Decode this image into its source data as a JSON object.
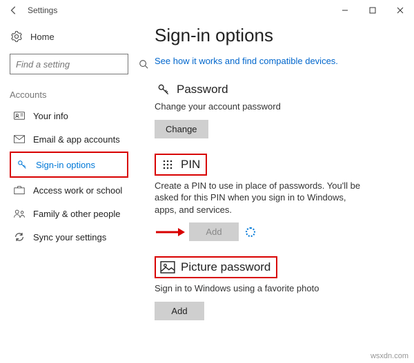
{
  "window": {
    "title": "Settings"
  },
  "sidebar": {
    "home": "Home",
    "search_placeholder": "Find a setting",
    "group": "Accounts",
    "items": [
      {
        "label": "Your info"
      },
      {
        "label": "Email & app accounts"
      },
      {
        "label": "Sign-in options"
      },
      {
        "label": "Access work or school"
      },
      {
        "label": "Family & other people"
      },
      {
        "label": "Sync your settings"
      }
    ]
  },
  "main": {
    "title": "Sign-in options",
    "link": "See how it works and find compatible devices.",
    "password": {
      "heading": "Password",
      "desc": "Change your account password",
      "button": "Change"
    },
    "pin": {
      "heading": "PIN",
      "desc": "Create a PIN to use in place of passwords. You'll be asked for this PIN when you sign in to Windows, apps, and services.",
      "button": "Add"
    },
    "picture": {
      "heading": "Picture password",
      "desc": "Sign in to Windows using a favorite photo",
      "button": "Add"
    }
  },
  "watermark": "wsxdn.com"
}
